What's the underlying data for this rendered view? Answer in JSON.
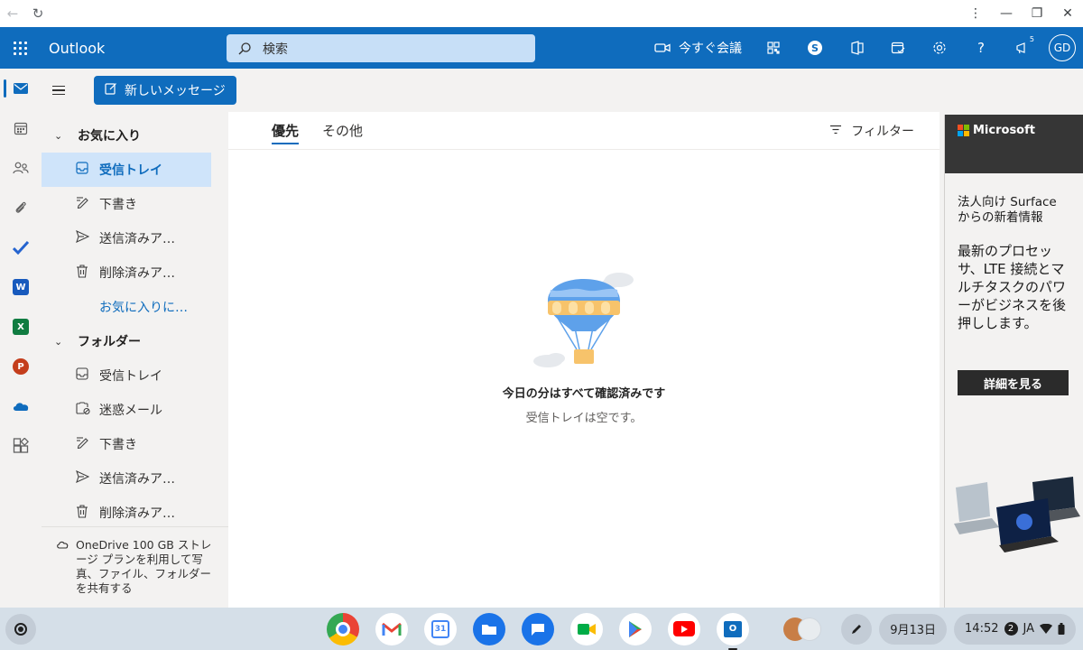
{
  "browser": {
    "back_icon": "back-arrow-icon",
    "reload_icon": "reload-icon",
    "menu_icon": "more-vert-icon",
    "minimize_icon": "minimize-icon",
    "restore_icon": "restore-icon",
    "close_icon": "close-icon"
  },
  "header": {
    "brand": "Outlook",
    "search_placeholder": "検索",
    "meet_now_label": "今すぐ会議",
    "notification_count": "5",
    "avatar_initials": "GD",
    "color": "#0f6cbd"
  },
  "compose": {
    "new_message_label": "新しいメッセージ"
  },
  "folders": {
    "favorites_title": "お気に入り",
    "favorites": [
      {
        "label": "受信トレイ",
        "icon": "inbox-icon",
        "selected": true
      },
      {
        "label": "下書き",
        "icon": "draft-pencil-icon"
      },
      {
        "label": "送信済みア…",
        "icon": "send-icon"
      },
      {
        "label": "削除済みア…",
        "icon": "trash-icon"
      }
    ],
    "add_favorite_label": "お気に入りに…",
    "folders_title": "フォルダー",
    "folders": [
      {
        "label": "受信トレイ",
        "icon": "inbox-icon"
      },
      {
        "label": "迷惑メール",
        "icon": "junk-icon"
      },
      {
        "label": "下書き",
        "icon": "draft-pencil-icon"
      },
      {
        "label": "送信済みア…",
        "icon": "send-icon"
      },
      {
        "label": "削除済みア…",
        "icon": "trash-icon"
      }
    ],
    "onedrive_promo": "OneDrive 100 GB ストレージ プランを利用して写真、ファイル、フォルダーを共有する"
  },
  "tabs": [
    {
      "label": "優先",
      "active": true
    },
    {
      "label": "その他",
      "active": false
    }
  ],
  "filter_label": "フィルター",
  "empty_state": {
    "title": "今日の分はすべて確認済みです",
    "subtitle": "受信トレイは空です。"
  },
  "ad": {
    "brand": "Microsoft",
    "headline": "法人向け Surface からの新着情報",
    "body": "最新のプロセッサ、LTE 接続とマルチタスクのパワーがビジネスを後押しします。",
    "button": "詳細を見る"
  },
  "taskbar": {
    "date": "9月13日",
    "time": "14:52",
    "notification_count": "2",
    "ime": "JA"
  }
}
